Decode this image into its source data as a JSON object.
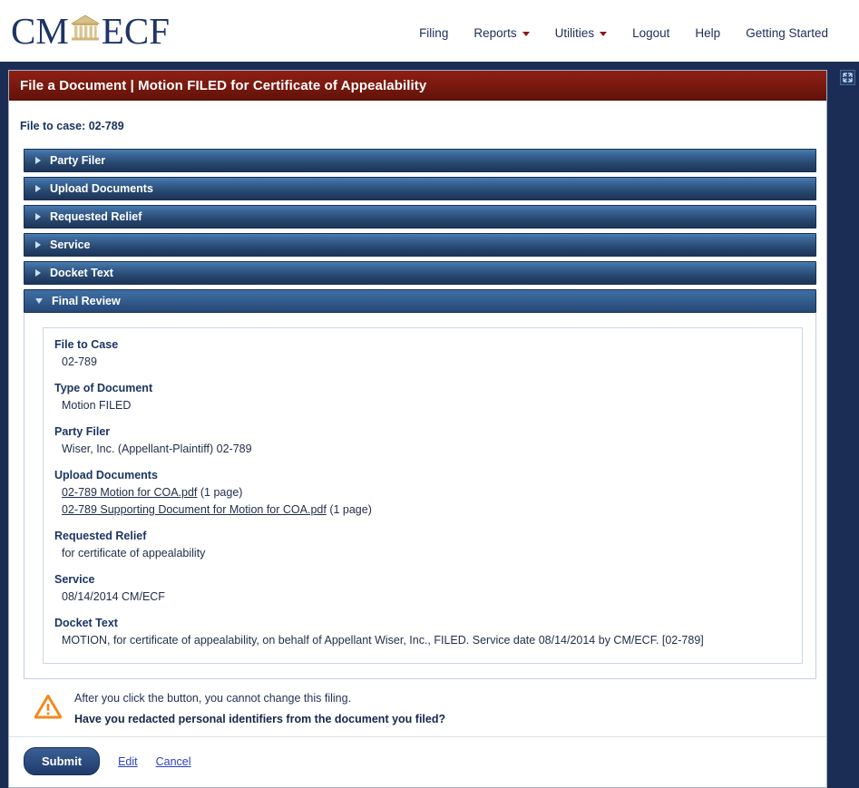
{
  "brand": {
    "cm": "CM",
    "ecf": "ECF",
    "courthouse_icon": "courthouse-icon"
  },
  "nav": {
    "items": [
      {
        "label": "Filing",
        "has_caret": false
      },
      {
        "label": "Reports",
        "has_caret": true
      },
      {
        "label": "Utilities",
        "has_caret": true
      },
      {
        "label": "Logout",
        "has_caret": false
      },
      {
        "label": "Help",
        "has_caret": false
      },
      {
        "label": "Getting Started",
        "has_caret": false
      }
    ]
  },
  "window": {
    "title": "File a Document | Motion FILED for Certificate of Appealability",
    "expand_icon": "fullscreen-expand-icon"
  },
  "case": {
    "file_to_case_line": "File to case: 02-789"
  },
  "accordion": {
    "sections": [
      {
        "label": "Party Filer",
        "expanded": false
      },
      {
        "label": "Upload Documents",
        "expanded": false
      },
      {
        "label": "Requested Relief",
        "expanded": false
      },
      {
        "label": "Service",
        "expanded": false
      },
      {
        "label": "Docket Text",
        "expanded": false
      },
      {
        "label": "Final Review",
        "expanded": true
      }
    ]
  },
  "review": {
    "file_to_case_label": "File to Case",
    "file_to_case_value": "02-789",
    "type_of_document_label": "Type of Document",
    "type_of_document_value": "Motion FILED",
    "party_filer_label": "Party Filer",
    "party_filer_value": "Wiser, Inc. (Appellant-Plaintiff) 02-789",
    "upload_documents_label": "Upload Documents",
    "documents": [
      {
        "name": "02-789 Motion for COA.pdf",
        "pages": "(1 page)"
      },
      {
        "name": "02-789 Supporting Document for Motion for COA.pdf",
        "pages": "(1 page)"
      }
    ],
    "requested_relief_label": "Requested Relief",
    "requested_relief_value": "for certificate of appealability",
    "service_label": "Service",
    "service_value": "08/14/2014 CM/ECF",
    "docket_text_label": "Docket Text",
    "docket_text_value": "MOTION, for certificate of appealability, on behalf of Appellant Wiser, Inc., FILED. Service date 08/14/2014 by CM/ECF. [02-789]"
  },
  "warning": {
    "icon": "warning-triangle-icon",
    "line1": "After you click the button, you cannot change this filing.",
    "line2": "Have you redacted personal identifiers from the document you filed?"
  },
  "actions": {
    "submit_label": "Submit",
    "edit_label": "Edit",
    "cancel_label": "Cancel"
  },
  "colors": {
    "page_bg": "#1b2d54",
    "title_red": "#7c1a10",
    "accordion_blue": "#2c5181",
    "brand_navy": "#1f3566",
    "brand_gold": "#c9a96a",
    "warning_orange": "#f08a1e",
    "link_blue": "#2b3fc4"
  }
}
